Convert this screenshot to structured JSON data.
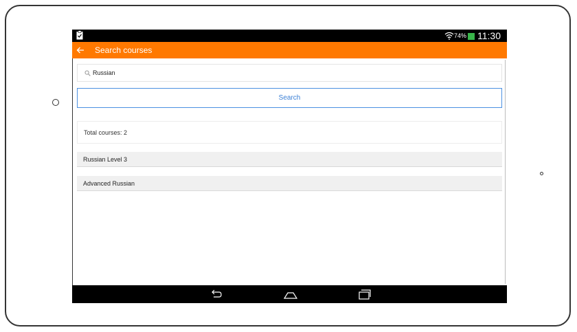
{
  "status_bar": {
    "battery_percent": "74%",
    "time": "11:30",
    "battery_color": "#39b54a"
  },
  "app_bar": {
    "title": "Search courses",
    "color": "#ff7900",
    "back_icon": "arrow-left-icon"
  },
  "search": {
    "query": "Russian",
    "button_label": "Search",
    "icon": "search-icon"
  },
  "results": {
    "total_label": "Total courses: 2",
    "courses": [
      "Russian Level 3",
      "Advanced Russian"
    ]
  },
  "nav_bar": {
    "buttons": [
      "back-icon",
      "home-icon",
      "recents-icon"
    ]
  }
}
